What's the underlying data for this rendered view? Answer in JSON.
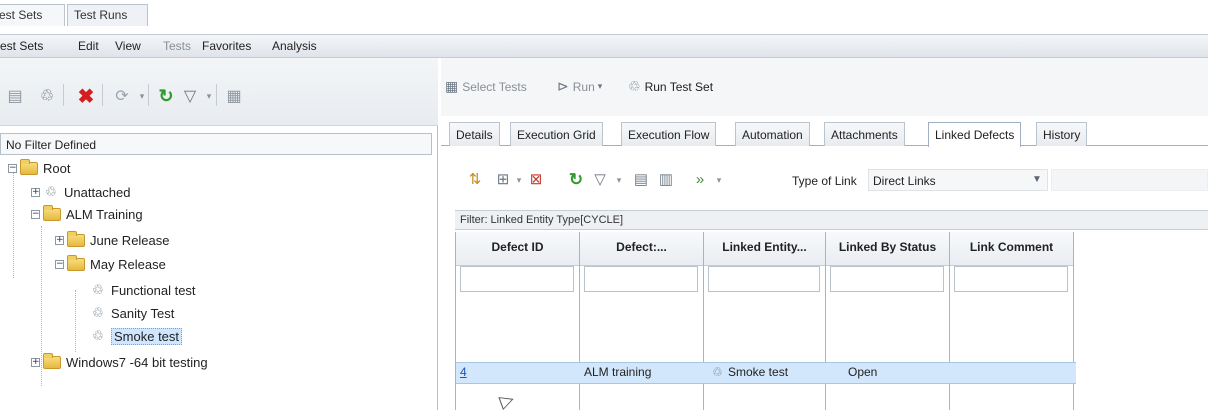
{
  "top_tabs": [
    "est Sets",
    "Test Runs"
  ],
  "menu": [
    "est Sets",
    "Edit",
    "View",
    "Tests",
    "Favorites",
    "Analysis"
  ],
  "left_filter": "No Filter Defined",
  "tree": {
    "root": "Root",
    "unattached": "Unattached",
    "alm_training": "ALM Training",
    "june_release": "June Release",
    "may_release": "May Release",
    "functional_test": "Functional test",
    "sanity_test": "Sanity Test",
    "smoke_test": "Smoke test",
    "windows7": "Windows7 -64 bit testing"
  },
  "right_toolbar": {
    "select_tests": "Select Tests",
    "run": "Run",
    "run_test_set": "Run Test Set"
  },
  "detail_tabs": [
    "Details",
    "Execution Grid",
    "Execution Flow",
    "Automation",
    "Attachments",
    "Linked Defects",
    "History"
  ],
  "active_tab": "Linked Defects",
  "link_type": {
    "label": "Type of Link",
    "value": "Direct Links"
  },
  "grid_filter": "Filter: Linked Entity Type[CYCLE]",
  "grid": {
    "columns": [
      "Defect ID",
      "Defect:...",
      "Linked Entity...",
      "Linked By Status",
      "Link Comment"
    ],
    "rows": [
      {
        "defect_id": "4",
        "defect": "ALM training",
        "linked_entity": "Smoke test",
        "status": "Open",
        "comment": ""
      }
    ]
  },
  "icons": {
    "delete": "x-icon",
    "refresh": "refresh-icon",
    "filter": "funnel-icon"
  },
  "colors": {
    "selection": "#d2e7fb",
    "folder": "#e6b83e",
    "delete": "#d41e1e",
    "refresh": "#2f9b2f"
  }
}
